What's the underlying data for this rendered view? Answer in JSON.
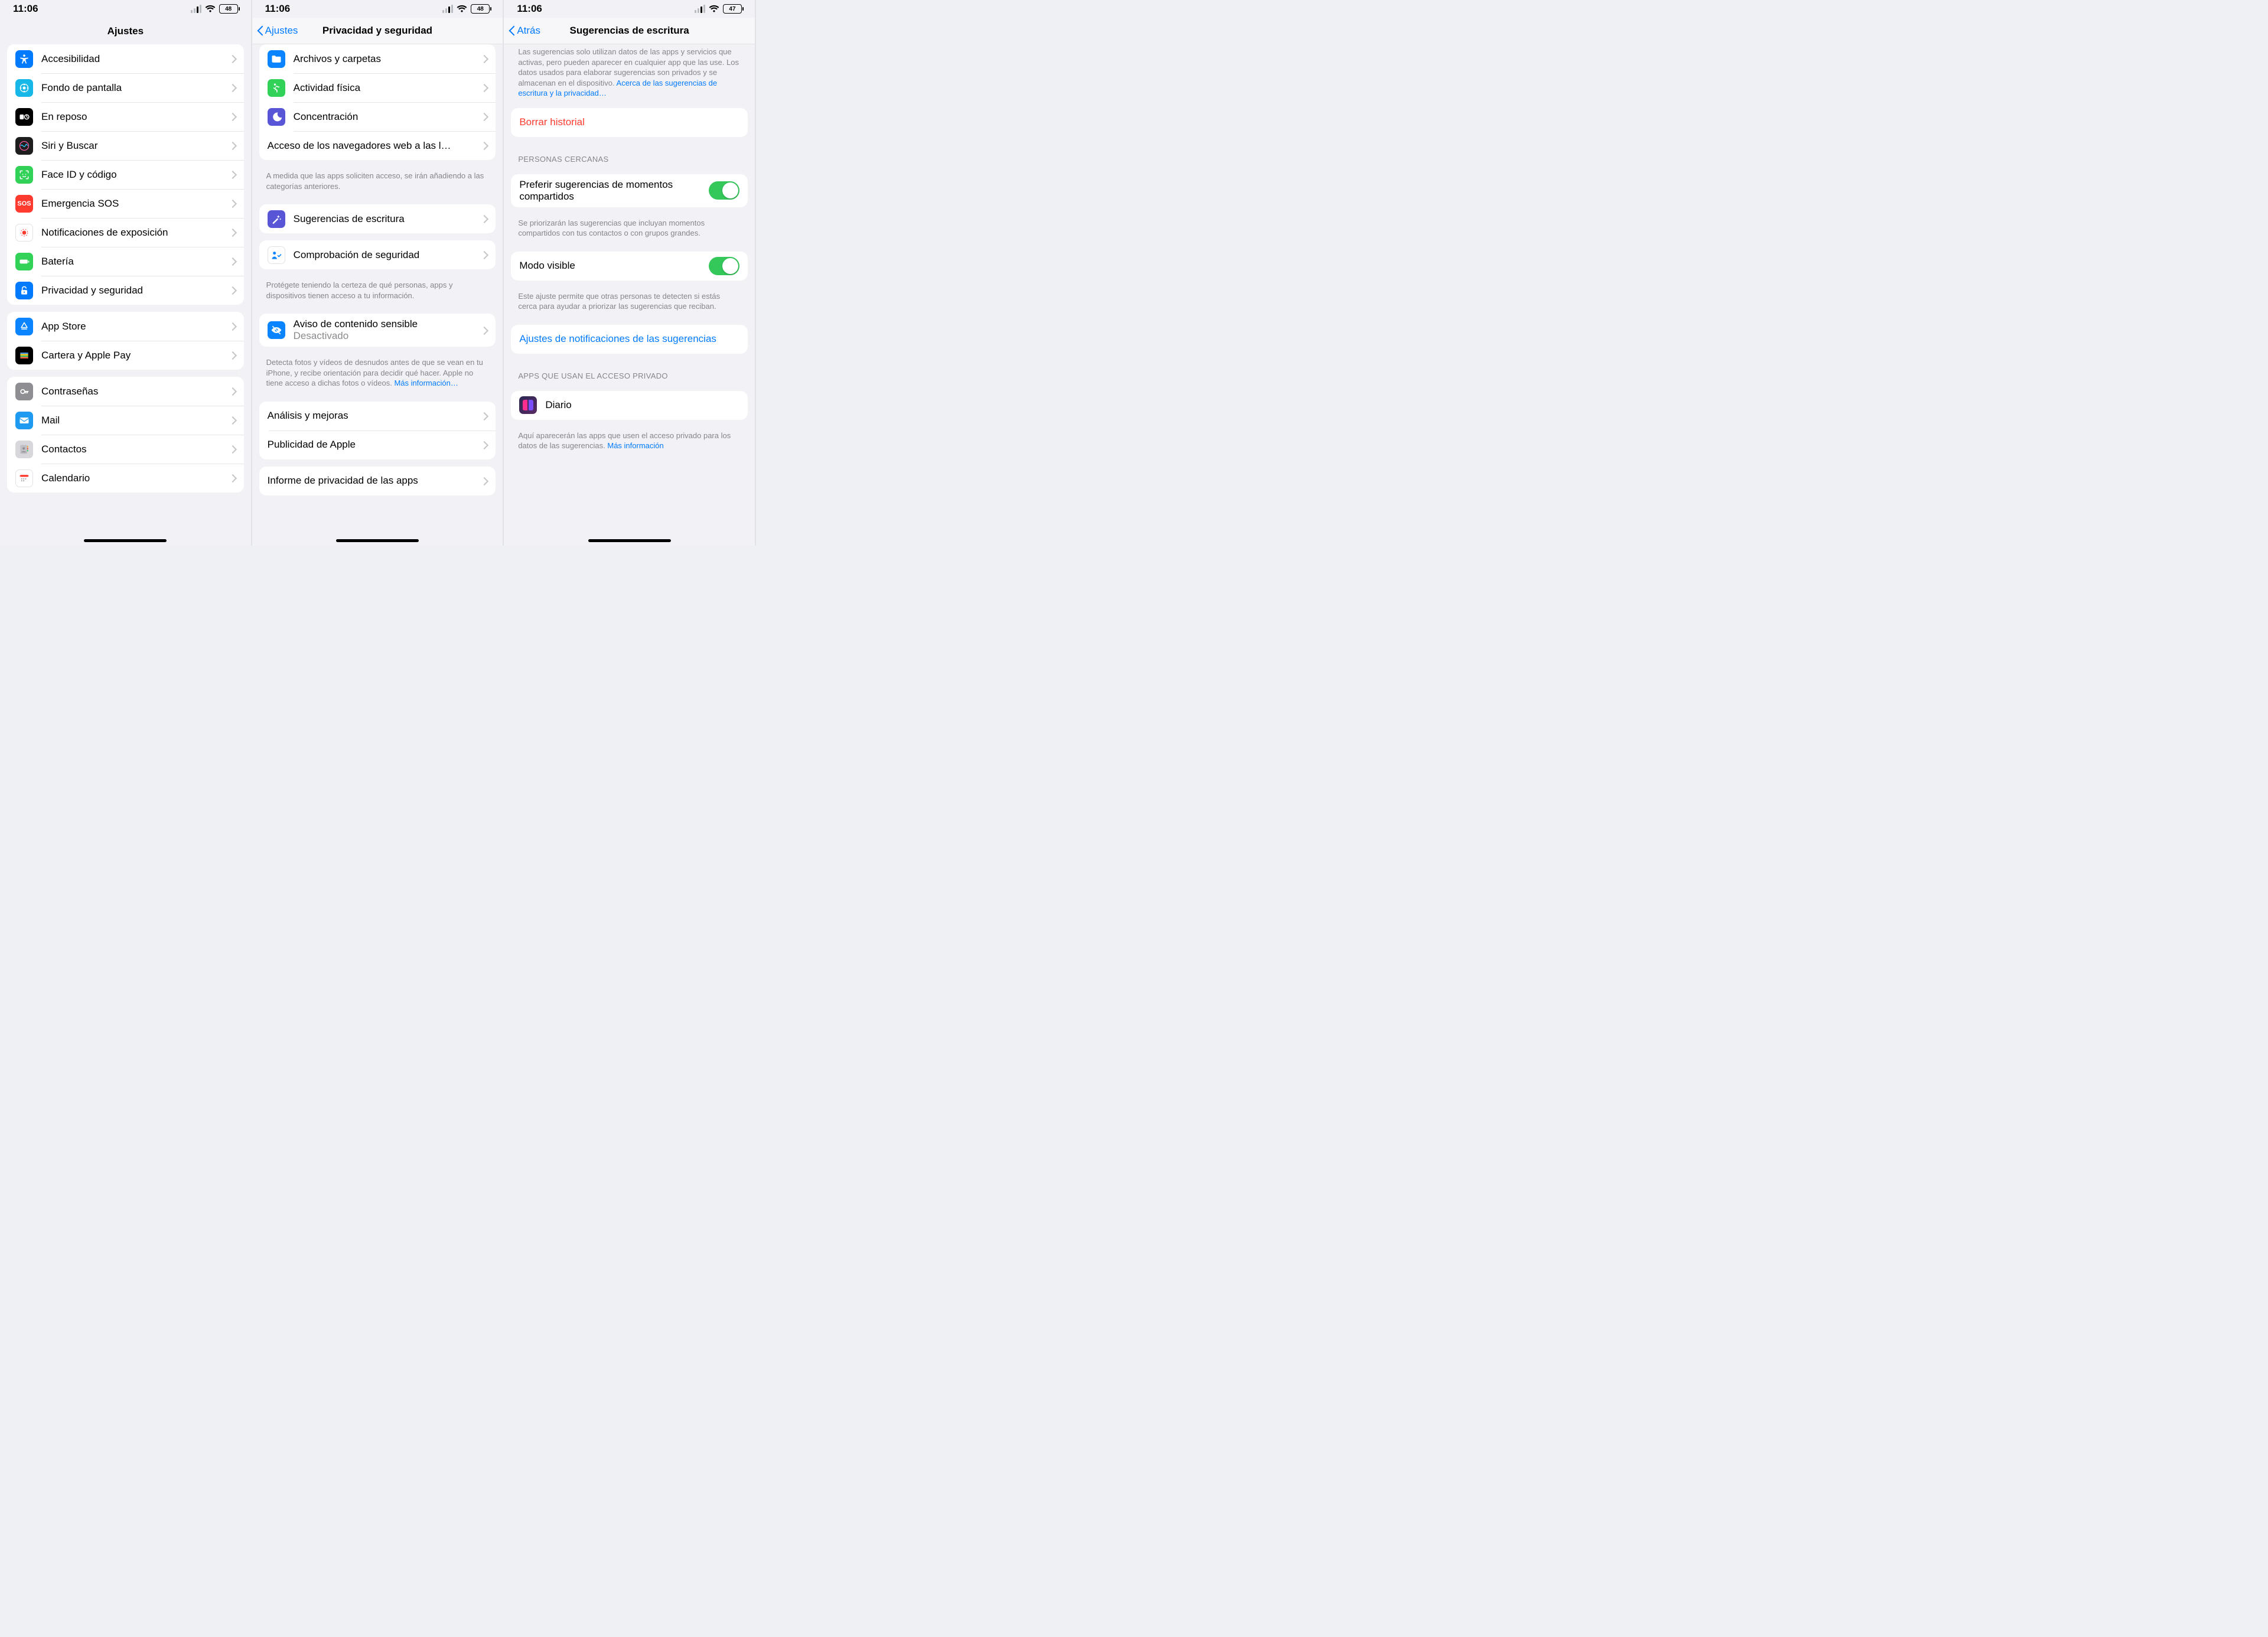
{
  "statusbar": {
    "time": "11:06",
    "battery_a": "48",
    "battery_c": "47"
  },
  "pane1": {
    "title": "Ajustes",
    "groupA": [
      {
        "label": "Accesibilidad",
        "icon": "accessibility",
        "bg": "#007aff"
      },
      {
        "label": "Fondo de pantalla",
        "icon": "wallpaper",
        "bg": "#17b7e8"
      },
      {
        "label": "En reposo",
        "icon": "standby",
        "bg": "#000000"
      },
      {
        "label": "Siri y Buscar",
        "icon": "siri",
        "bg": "#1e1e1e"
      },
      {
        "label": "Face ID y código",
        "icon": "faceid",
        "bg": "#32d158"
      },
      {
        "label": "Emergencia SOS",
        "icon": "sos",
        "bg": "#ff3b30"
      },
      {
        "label": "Notificaciones de exposición",
        "icon": "exposure",
        "bg": "#ffffff"
      },
      {
        "label": "Batería",
        "icon": "battery",
        "bg": "#32d158"
      },
      {
        "label": "Privacidad y seguridad",
        "icon": "privacy",
        "bg": "#007aff"
      }
    ],
    "groupB": [
      {
        "label": "App Store",
        "icon": "appstore",
        "bg": "#0a84ff"
      },
      {
        "label": "Cartera y Apple Pay",
        "icon": "wallet",
        "bg": "#000000"
      }
    ],
    "groupC": [
      {
        "label": "Contraseñas",
        "icon": "passwords",
        "bg": "#8e8e93"
      },
      {
        "label": "Mail",
        "icon": "mail",
        "bg": "#1e9bf1"
      },
      {
        "label": "Contactos",
        "icon": "contacts",
        "bg": "#d8d8dc"
      },
      {
        "label": "Calendario",
        "icon": "calendar",
        "bg": "#ffffff"
      }
    ]
  },
  "pane2": {
    "back": "Ajustes",
    "title": "Privacidad y seguridad",
    "groupTop": [
      {
        "label": "Archivos y carpetas",
        "icon": "folder",
        "bg": "#0a84ff"
      },
      {
        "label": "Actividad física",
        "icon": "fitness",
        "bg": "#32d158"
      },
      {
        "label": "Concentración",
        "icon": "focus",
        "bg": "#5856d6"
      },
      {
        "label": "Acceso de los navegadores web a las l…",
        "no_icon": true
      }
    ],
    "noteTop": "A medida que las apps soliciten acceso, se irán añadiendo a las categorías anteriores.",
    "groupSuggest": [
      {
        "label": "Sugerencias de escritura",
        "icon": "wand",
        "bg": "#5856d6"
      }
    ],
    "groupSafety": [
      {
        "label": "Comprobación de seguridad",
        "icon": "safety",
        "bg": "#ffffff"
      }
    ],
    "noteSafety": "Protégete teniendo la certeza de qué personas, apps y dispositivos tienen acceso a tu información.",
    "groupSensitive": [
      {
        "label": "Aviso de contenido sensible",
        "sub": "Desactivado",
        "icon": "eye",
        "bg": "#0a84ff"
      }
    ],
    "noteSensitive": "Detecta fotos y vídeos de desnudos antes de que se vean en tu iPhone, y recibe orientación para decidir qué hacer. Apple no tiene acceso a dichas fotos o vídeos. ",
    "noteSensitiveLink": "Más información…",
    "groupAnalytics": [
      {
        "label": "Análisis y mejoras"
      },
      {
        "label": "Publicidad de Apple"
      }
    ],
    "groupReport": [
      {
        "label": "Informe de privacidad de las apps"
      }
    ]
  },
  "pane3": {
    "back": "Atrás",
    "title": "Sugerencias de escritura",
    "introTrail": "Las sugerencias solo utilizan datos de las apps y servicios que activas, pero pueden aparecer en cualquier app que las use. Los datos usados para elaborar sugerencias son privados y se almacenan en el dispositivo. ",
    "introLink": "Acerca de las sugerencias de escritura y la privacidad…",
    "clearHistory": "Borrar historial",
    "section_personas": "PERSONAS CERCANAS",
    "toggle1": "Preferir sugerencias de momentos compartidos",
    "note1": "Se priorizarán las sugerencias que incluyan momentos compartidos con tus contactos o con grupos grandes.",
    "toggle2": "Modo visible",
    "note2": "Este ajuste permite que otras personas te detecten si estás cerca para ayudar a priorizar las sugerencias que reciban.",
    "link_notif": "Ajustes de notificaciones de las sugerencias",
    "section_apps": "APPS QUE USAN EL ACCESO PRIVADO",
    "app1": "Diario",
    "note_apps": "Aquí aparecerán las apps que usen el acceso privado para los datos de las sugerencias. ",
    "note_apps_link": "Más información"
  }
}
